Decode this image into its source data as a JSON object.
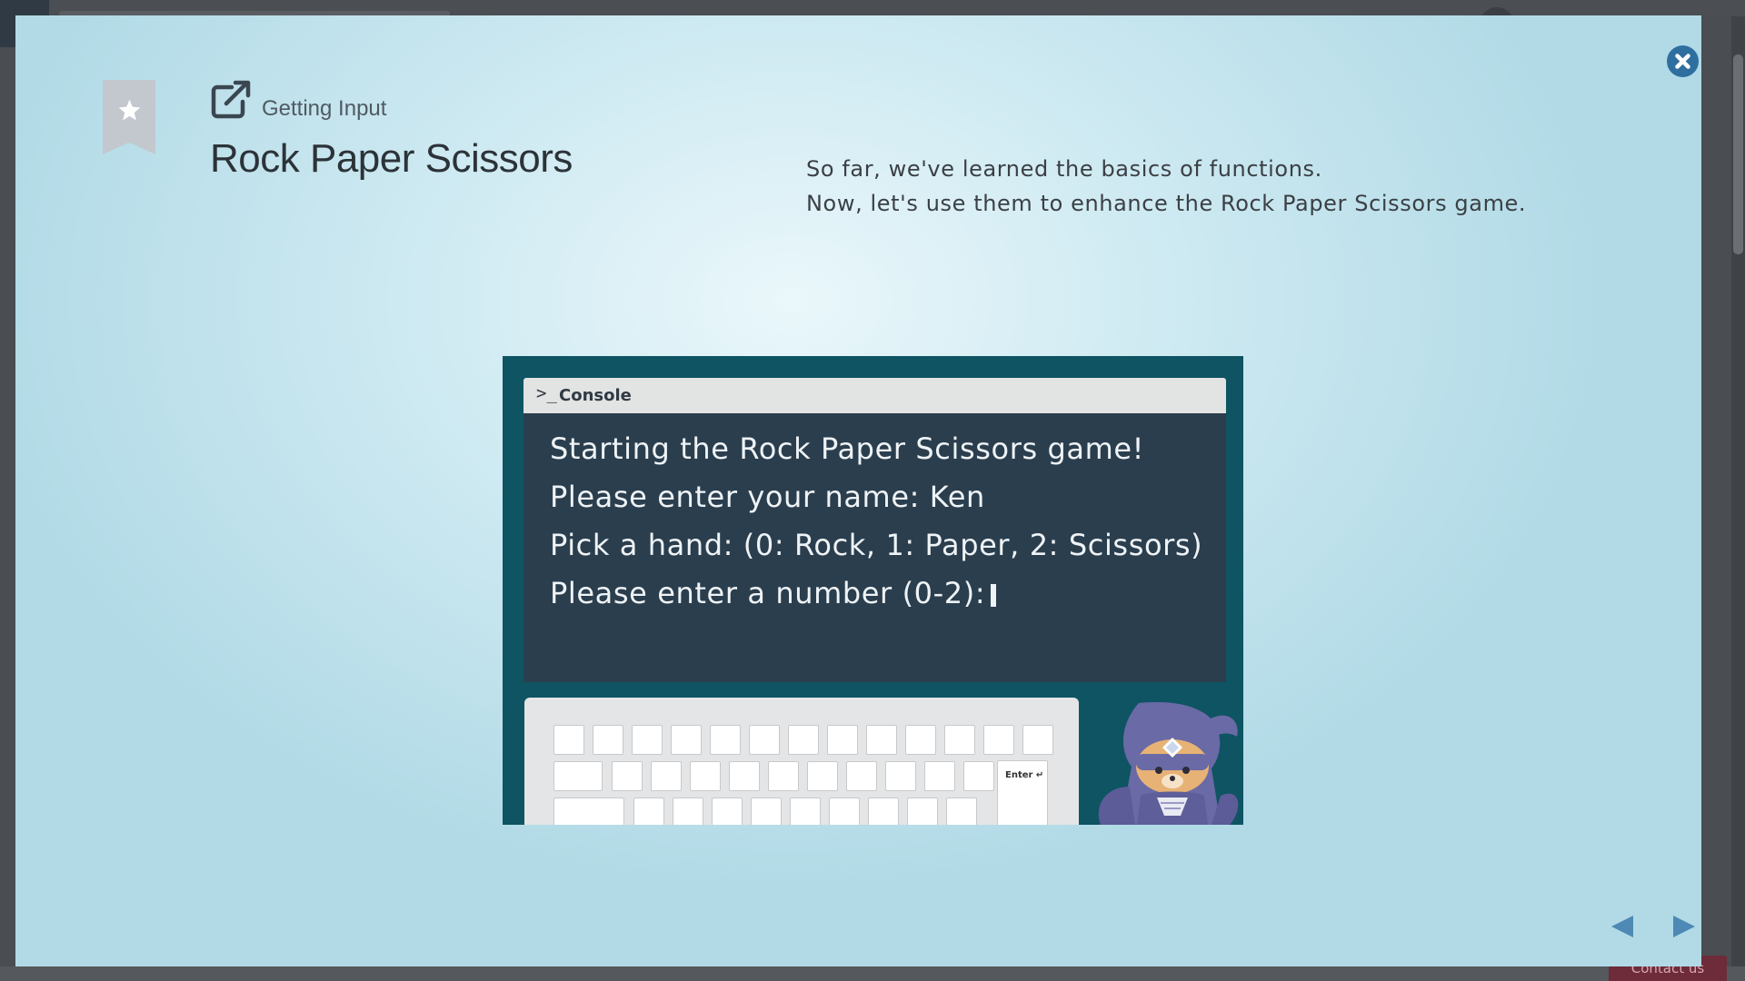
{
  "lesson": {
    "subtitle": "Getting Input",
    "title": "Rock Paper Scissors",
    "description": [
      "So far, we've learned the basics of functions.",
      "Now, let's use them to enhance the Rock Paper Scissors game."
    ]
  },
  "console": {
    "prompt_symbol": ">_",
    "label": "Console",
    "lines": [
      "Starting the Rock Paper Scissors game!",
      "Please enter your name: Ken",
      "Pick a hand: (0: Rock, 1: Paper, 2: Scissors)",
      "Please enter a number (0-2):"
    ]
  },
  "keyboard": {
    "enter_label": "Enter ↵"
  },
  "backdrop": {
    "contact_label": "Contact us"
  },
  "icons": {
    "bookmark": "star-bookmark-icon",
    "external": "external-link-icon",
    "close": "close-icon",
    "prev": "triangle-left-icon",
    "next": "triangle-right-icon"
  },
  "colors": {
    "modal_bg": "#cfeaf2",
    "stage_bg": "#0e5463",
    "console_bg": "#2b3e4e",
    "nav_arrow": "#4e89b5",
    "close_button": "#2f6fa0"
  }
}
